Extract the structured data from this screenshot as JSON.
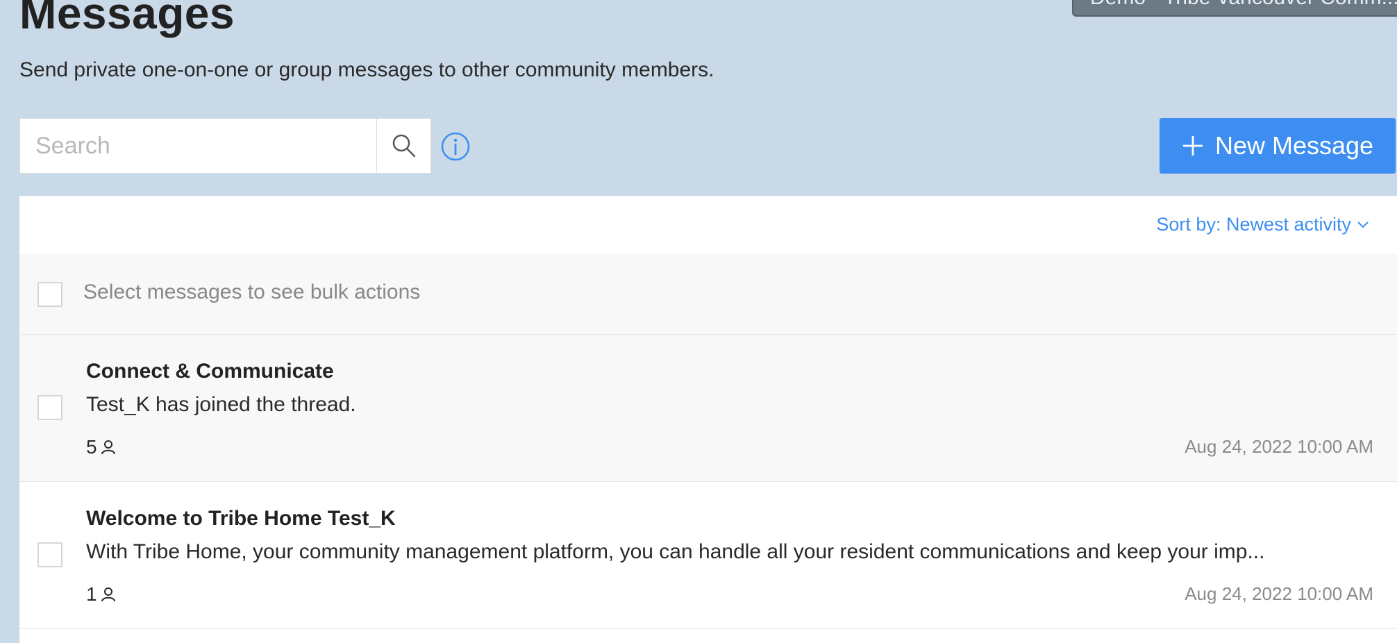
{
  "header": {
    "community_switcher": "Demo - Tribe Vancouver Comm...",
    "title": "Messages",
    "subtitle": "Send private one-on-one or group messages to other community members."
  },
  "search": {
    "placeholder": "Search",
    "value": ""
  },
  "actions": {
    "new_message_label": "New Message"
  },
  "list": {
    "sort_label": "Sort by: Newest activity",
    "bulk_hint": "Select messages to see bulk actions",
    "threads": [
      {
        "title": "Connect & Communicate",
        "preview": "Test_K has joined the thread.",
        "members": "5",
        "date": "Aug 24, 2022 10:00 AM"
      },
      {
        "title": "Welcome to Tribe Home Test_K",
        "preview": "With Tribe Home, your community management platform, you can handle all your resident communications and keep your imp...",
        "members": "1",
        "date": "Aug 24, 2022 10:00 AM"
      }
    ]
  },
  "colors": {
    "background": "#c9d9e8",
    "accent": "#3d8ef0",
    "switcher": "#6c7a86"
  },
  "icons": {
    "search": "magnifier-icon",
    "info": "info-circle-icon",
    "plus": "plus-icon",
    "sort": "chevron-down-icon",
    "members": "person-icon"
  }
}
